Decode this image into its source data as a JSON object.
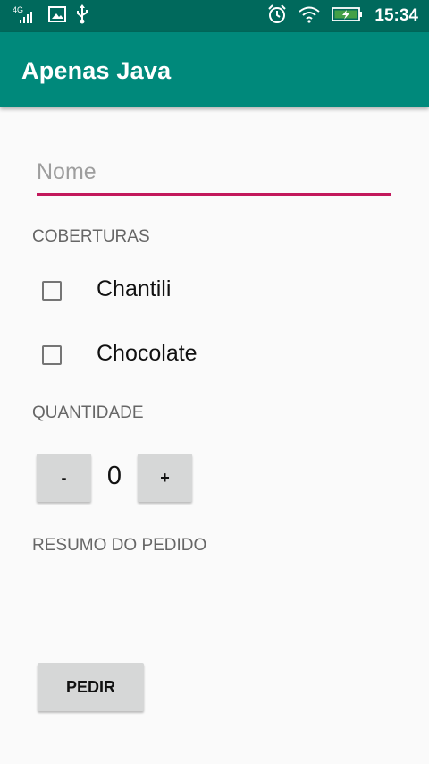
{
  "status_bar": {
    "network_label": "4G",
    "time": "15:34",
    "icons": [
      "signal-icon",
      "image-icon",
      "usb-icon",
      "alarm-icon",
      "wifi-icon",
      "battery-charging-icon"
    ]
  },
  "app_bar": {
    "title": "Apenas Java"
  },
  "form": {
    "name_placeholder": "Nome",
    "name_value": "",
    "toppings_label": "COBERTURAS",
    "toppings": [
      {
        "label": "Chantili",
        "checked": false
      },
      {
        "label": "Chocolate",
        "checked": false
      }
    ],
    "quantity_label": "QUANTIDADE",
    "decrement_label": "-",
    "quantity_value": "0",
    "increment_label": "+",
    "summary_label": "RESUMO DO PEDIDO",
    "order_button_label": "PEDIR"
  },
  "colors": {
    "status_bar": "#00695c",
    "app_bar": "#00897b",
    "accent": "#c2185b",
    "background": "#fafafa",
    "button": "#d6d7d7"
  }
}
